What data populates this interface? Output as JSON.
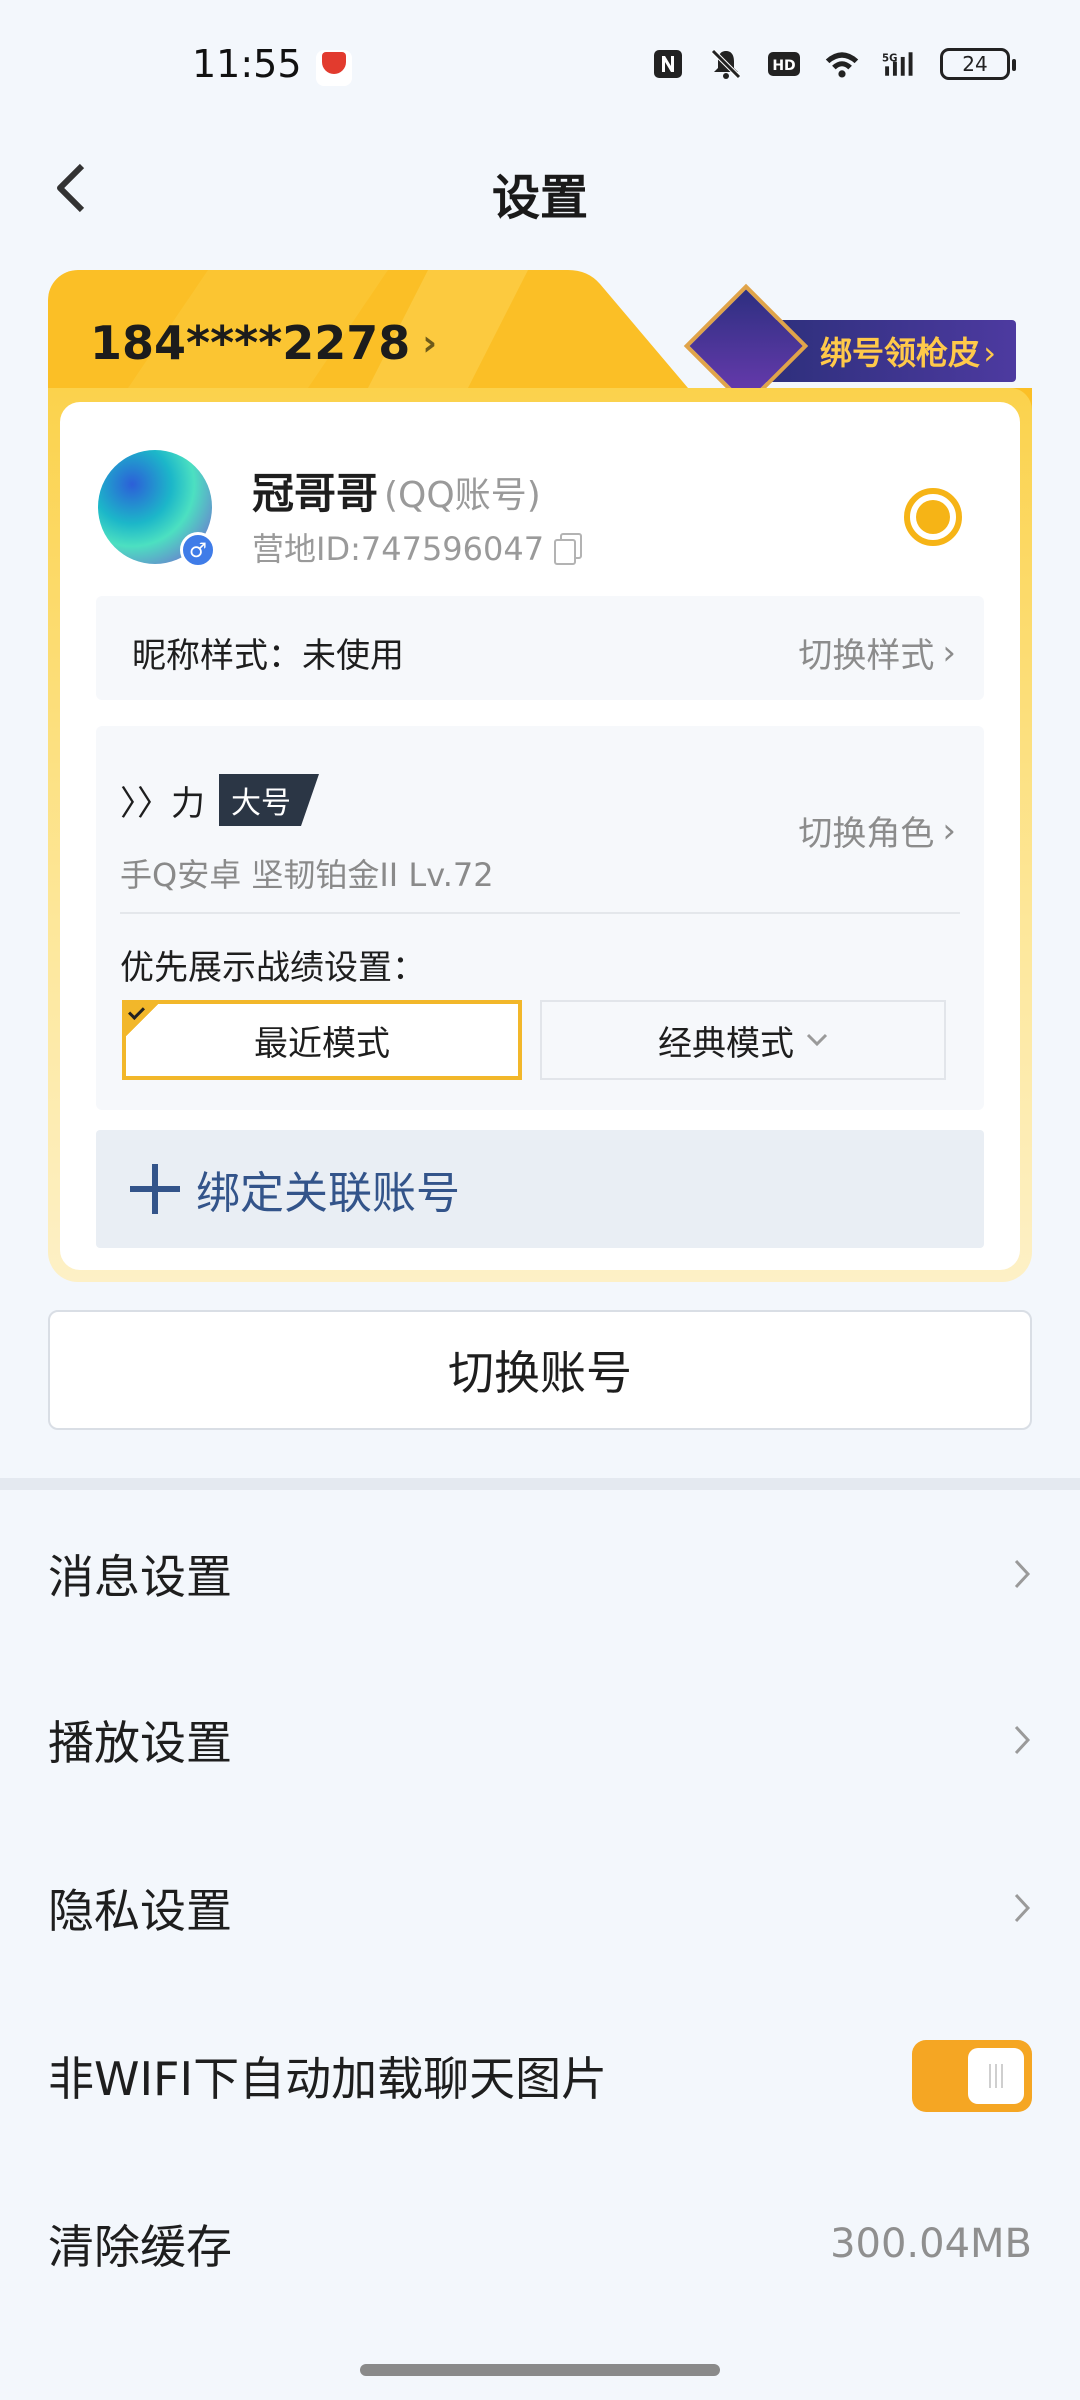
{
  "status_bar": {
    "time": "11:55",
    "icons": [
      "nfc-icon",
      "mute-icon",
      "hd-icon",
      "wifi-icon",
      "5g-signal-icon"
    ],
    "battery": "24"
  },
  "header": {
    "title": "设置"
  },
  "account_card": {
    "phone": "184****2278",
    "bind_promo": "绑号领枪皮",
    "nickname": "冠哥哥",
    "account_type": "(QQ账号)",
    "camp_id": "营地ID:747596047",
    "nick_style_label": "昵称样式：未使用",
    "switch_style": "切换样式",
    "role": {
      "name": "〉〉力",
      "badge": "大号",
      "info": "手Q安卓  坚韧铂金II  Lv.72",
      "switch_role": "切换角色"
    },
    "priority_label": "优先展示战绩设置：",
    "modes": {
      "recent": "最近模式",
      "classic": "经典模式"
    },
    "bind_linked": "绑定关联账号"
  },
  "switch_account": "切换账号",
  "settings": [
    {
      "label": "消息设置",
      "type": "chevron"
    },
    {
      "label": "播放设置",
      "type": "chevron"
    },
    {
      "label": "隐私设置",
      "type": "chevron"
    },
    {
      "label": "非WIFI下自动加载聊天图片",
      "type": "toggle",
      "on": true
    },
    {
      "label": "清除缓存",
      "type": "value",
      "value": "300.04MB"
    }
  ],
  "colors": {
    "accent": "#f5a623",
    "card_gold": "#fbd24c",
    "link_blue": "#33548a"
  }
}
